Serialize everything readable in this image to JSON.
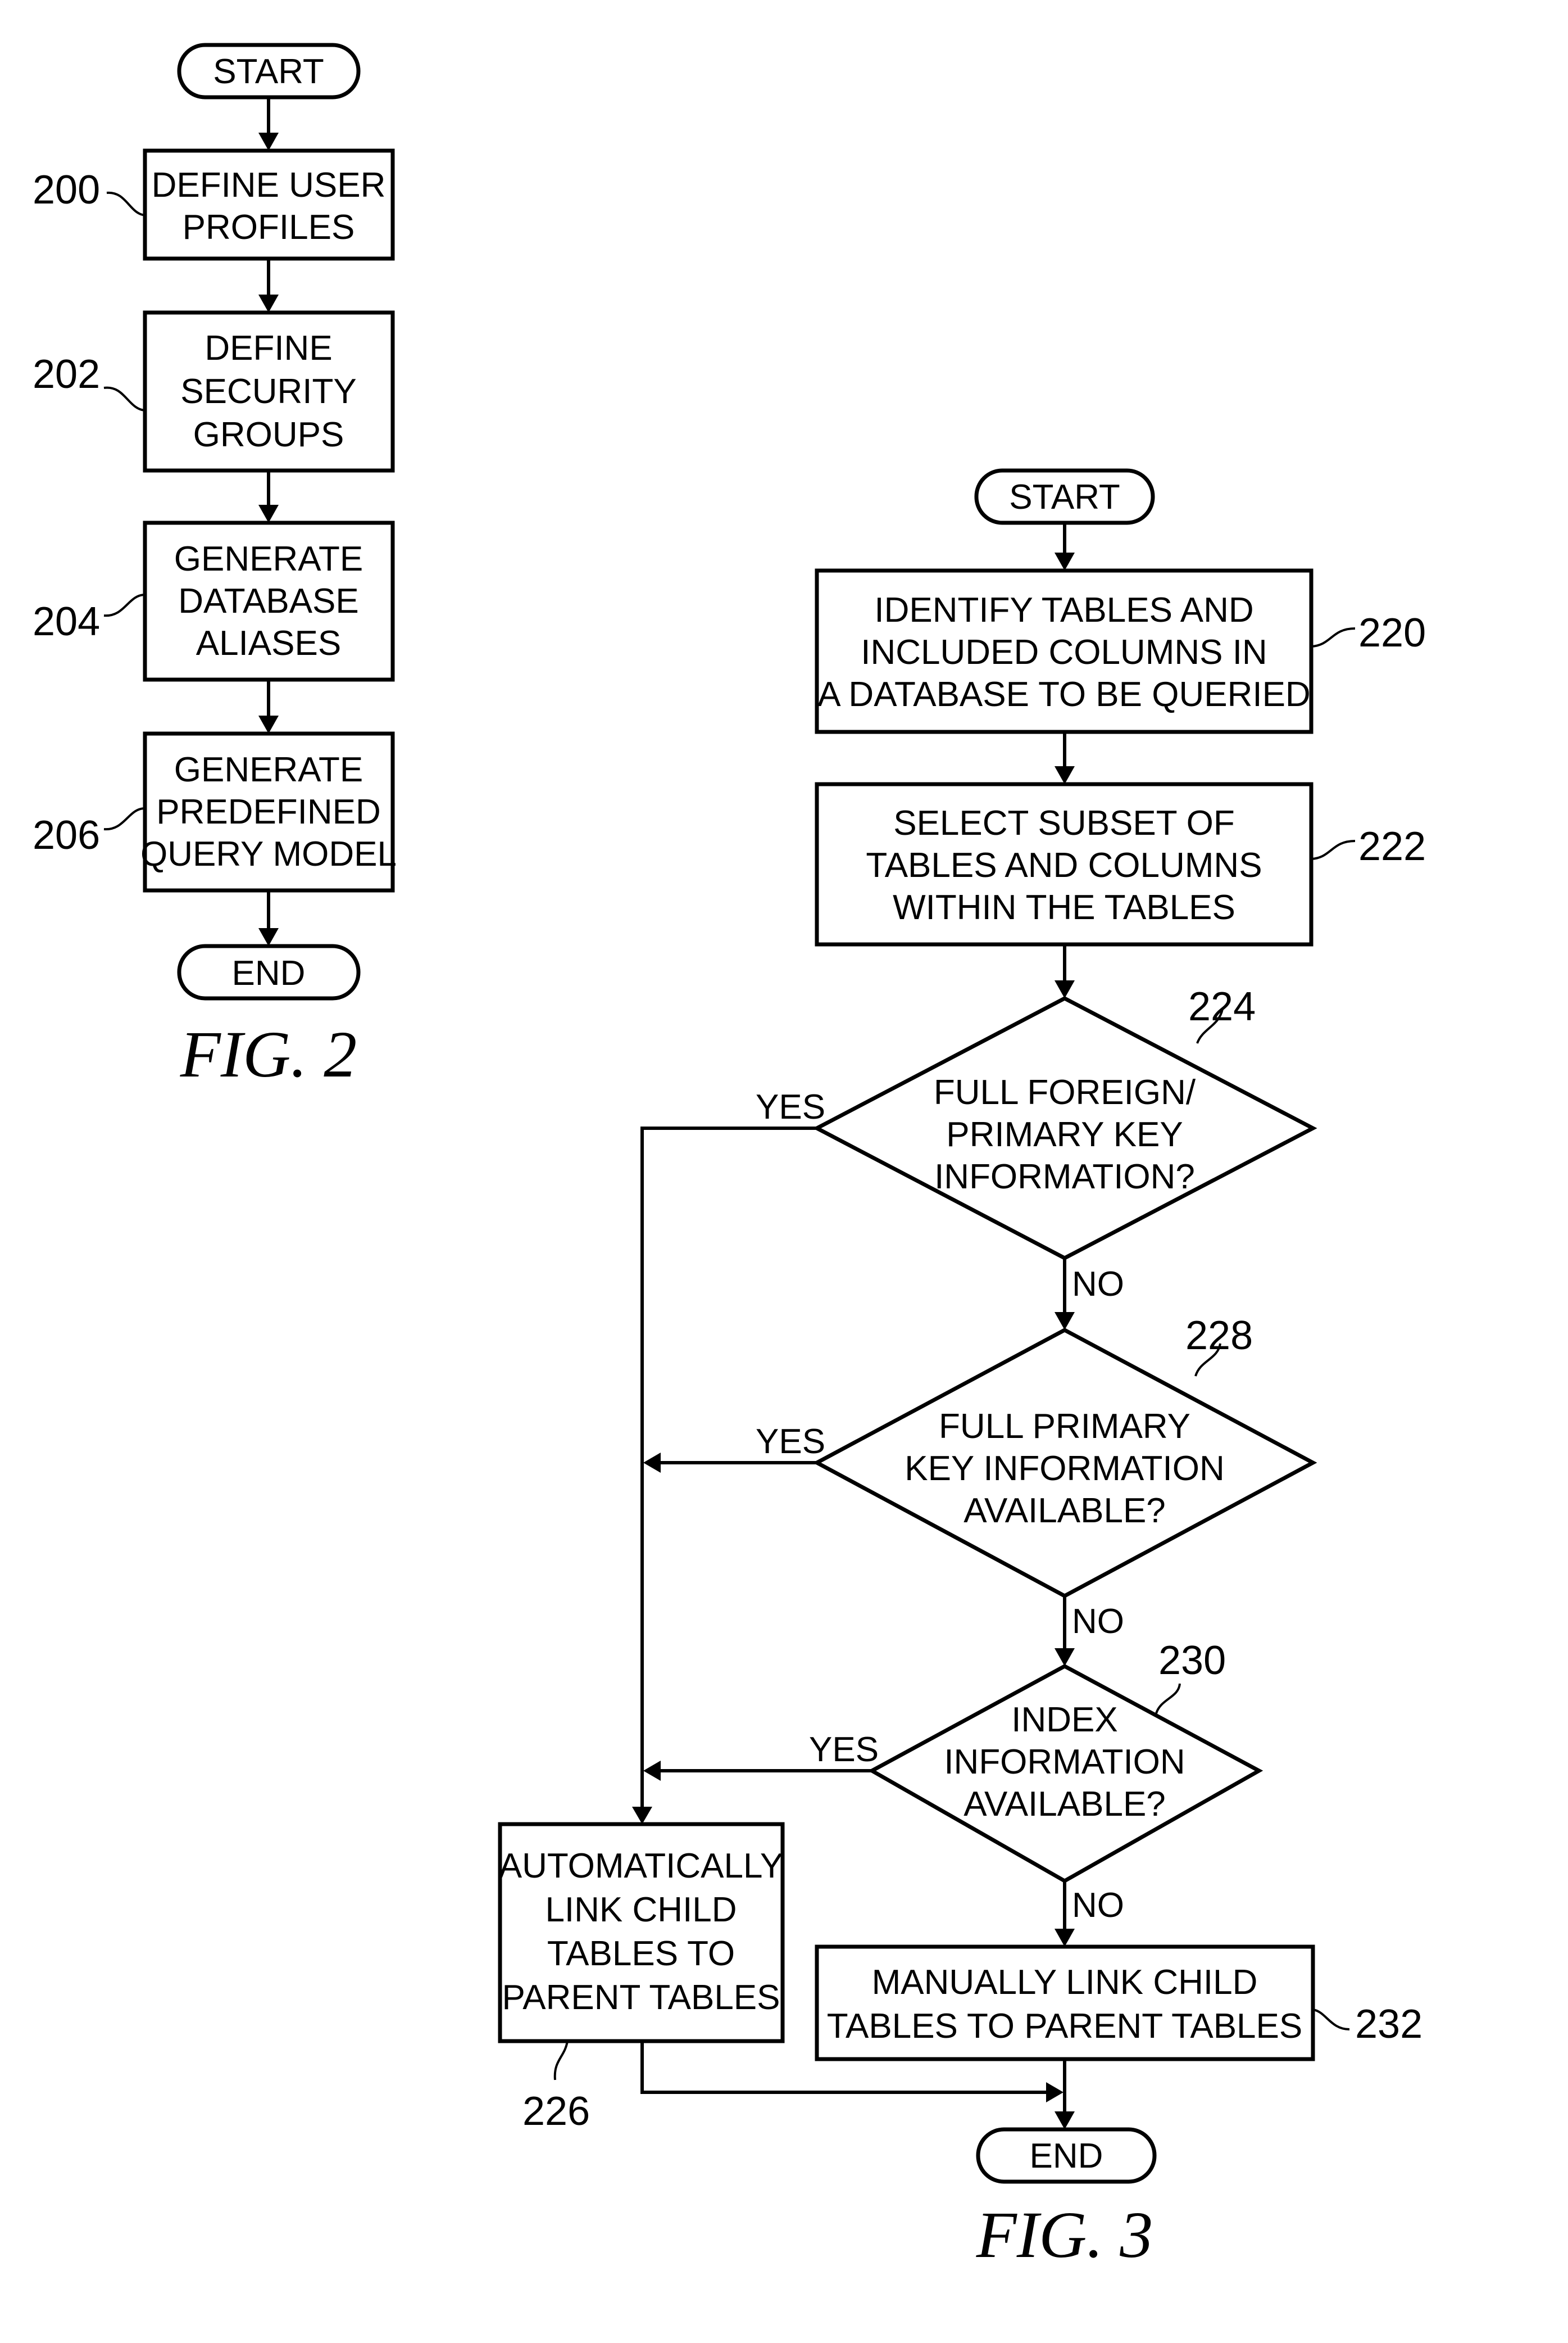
{
  "fig2": {
    "caption": "FIG. 2",
    "start": "START",
    "end": "END",
    "steps": [
      {
        "ref": "200",
        "lines": [
          "DEFINE USER",
          "PROFILES"
        ]
      },
      {
        "ref": "202",
        "lines": [
          "DEFINE",
          "SECURITY",
          "GROUPS"
        ]
      },
      {
        "ref": "204",
        "lines": [
          "GENERATE",
          "DATABASE",
          "ALIASES"
        ]
      },
      {
        "ref": "206",
        "lines": [
          "GENERATE",
          "PREDEFINED",
          "QUERY MODEL"
        ]
      }
    ]
  },
  "fig3": {
    "caption": "FIG. 3",
    "start": "START",
    "end": "END",
    "step220": {
      "ref": "220",
      "lines": [
        "IDENTIFY TABLES AND",
        "INCLUDED COLUMNS IN",
        "A DATABASE TO BE QUERIED"
      ]
    },
    "step222": {
      "ref": "222",
      "lines": [
        "SELECT SUBSET OF",
        "TABLES AND COLUMNS",
        "WITHIN THE TABLES"
      ]
    },
    "decision224": {
      "ref": "224",
      "lines": [
        "FULL FOREIGN/",
        "PRIMARY KEY",
        "INFORMATION?"
      ],
      "yes": "YES",
      "no": "NO"
    },
    "decision228": {
      "ref": "228",
      "lines": [
        "FULL PRIMARY",
        "KEY INFORMATION",
        "AVAILABLE?"
      ],
      "yes": "YES",
      "no": "NO"
    },
    "decision230": {
      "ref": "230",
      "lines": [
        "INDEX",
        "INFORMATION",
        "AVAILABLE?"
      ],
      "yes": "YES",
      "no": "NO"
    },
    "step226": {
      "ref": "226",
      "lines": [
        "AUTOMATICALLY",
        "LINK CHILD",
        "TABLES TO",
        "PARENT TABLES"
      ]
    },
    "step232": {
      "ref": "232",
      "lines": [
        "MANUALLY LINK CHILD",
        "TABLES TO PARENT TABLES"
      ]
    }
  }
}
